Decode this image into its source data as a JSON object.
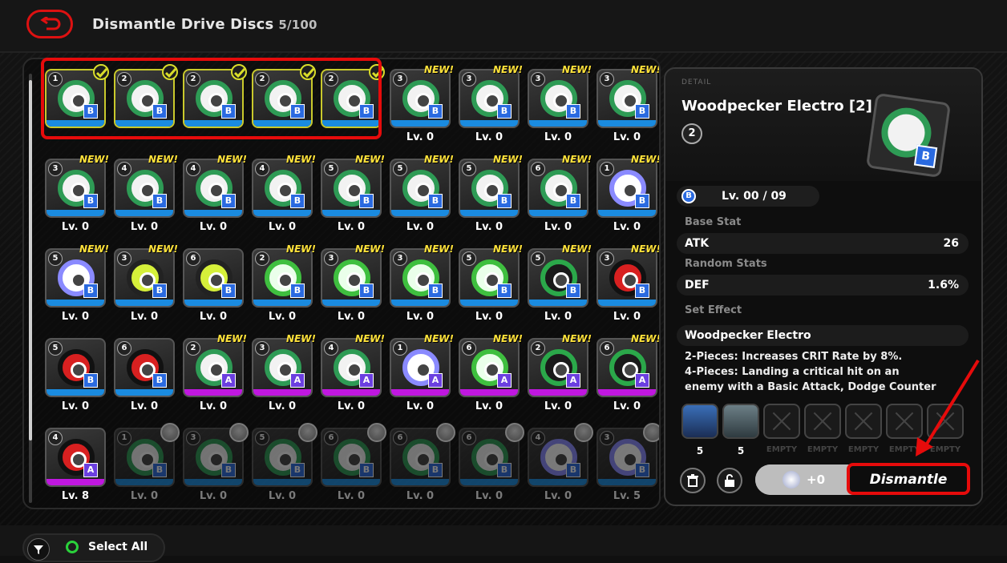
{
  "header": {
    "title": "Dismantle Drive Discs",
    "count": "5/100"
  },
  "grid": {
    "items": [
      {
        "rank": "1",
        "level": "",
        "tag": "check",
        "theme": "",
        "slot": "B",
        "bar": "blue",
        "selected": true
      },
      {
        "rank": "2",
        "level": "",
        "tag": "check",
        "theme": "",
        "slot": "B",
        "bar": "blue",
        "selected": true
      },
      {
        "rank": "2",
        "level": "",
        "tag": "check",
        "theme": "",
        "slot": "B",
        "bar": "blue",
        "selected": true
      },
      {
        "rank": "2",
        "level": "",
        "tag": "check",
        "theme": "",
        "slot": "B",
        "bar": "blue",
        "selected": true
      },
      {
        "rank": "2",
        "level": "",
        "tag": "check",
        "theme": "",
        "slot": "B",
        "bar": "blue",
        "selected": true
      },
      {
        "rank": "3",
        "level": "Lv. 0",
        "tag": "NEW!",
        "theme": "",
        "slot": "B",
        "bar": "blue"
      },
      {
        "rank": "3",
        "level": "Lv. 0",
        "tag": "NEW!",
        "theme": "",
        "slot": "B",
        "bar": "blue"
      },
      {
        "rank": "3",
        "level": "Lv. 0",
        "tag": "NEW!",
        "theme": "",
        "slot": "B",
        "bar": "blue"
      },
      {
        "rank": "3",
        "level": "Lv. 0",
        "tag": "NEW!",
        "theme": "",
        "slot": "B",
        "bar": "blue"
      },
      {
        "rank": "3",
        "level": "Lv. 0",
        "tag": "NEW!",
        "theme": "",
        "slot": "B",
        "bar": "blue"
      },
      {
        "rank": "4",
        "level": "Lv. 0",
        "tag": "NEW!",
        "theme": "",
        "slot": "B",
        "bar": "blue"
      },
      {
        "rank": "4",
        "level": "Lv. 0",
        "tag": "NEW!",
        "theme": "",
        "slot": "B",
        "bar": "blue"
      },
      {
        "rank": "4",
        "level": "Lv. 0",
        "tag": "NEW!",
        "theme": "",
        "slot": "B",
        "bar": "blue"
      },
      {
        "rank": "5",
        "level": "Lv. 0",
        "tag": "NEW!",
        "theme": "",
        "slot": "B",
        "bar": "blue"
      },
      {
        "rank": "5",
        "level": "Lv. 0",
        "tag": "NEW!",
        "theme": "",
        "slot": "B",
        "bar": "blue"
      },
      {
        "rank": "5",
        "level": "Lv. 0",
        "tag": "NEW!",
        "theme": "",
        "slot": "B",
        "bar": "blue"
      },
      {
        "rank": "6",
        "level": "Lv. 0",
        "tag": "NEW!",
        "theme": "",
        "slot": "B",
        "bar": "blue"
      },
      {
        "rank": "1",
        "level": "Lv. 0",
        "tag": "NEW!",
        "theme": "t-white",
        "slot": "B",
        "bar": "blue"
      },
      {
        "rank": "5",
        "level": "Lv. 0",
        "tag": "NEW!",
        "theme": "t-white",
        "slot": "B",
        "bar": "blue"
      },
      {
        "rank": "3",
        "level": "Lv. 0",
        "tag": "NEW!",
        "theme": "t-yellow",
        "slot": "B",
        "bar": "blue"
      },
      {
        "rank": "6",
        "level": "Lv. 0",
        "tag": "",
        "theme": "t-yellow",
        "slot": "B",
        "bar": "blue"
      },
      {
        "rank": "2",
        "level": "Lv. 0",
        "tag": "NEW!",
        "theme": "t-lime",
        "slot": "B",
        "bar": "blue"
      },
      {
        "rank": "3",
        "level": "Lv. 0",
        "tag": "NEW!",
        "theme": "t-lime",
        "slot": "B",
        "bar": "blue"
      },
      {
        "rank": "3",
        "level": "Lv. 0",
        "tag": "NEW!",
        "theme": "t-lime",
        "slot": "B",
        "bar": "blue"
      },
      {
        "rank": "5",
        "level": "Lv. 0",
        "tag": "NEW!",
        "theme": "t-lime",
        "slot": "B",
        "bar": "blue"
      },
      {
        "rank": "5",
        "level": "Lv. 0",
        "tag": "NEW!",
        "theme": "t-green",
        "slot": "B",
        "bar": "blue"
      },
      {
        "rank": "3",
        "level": "Lv. 0",
        "tag": "NEW!",
        "theme": "t-red",
        "slot": "B",
        "bar": "blue"
      },
      {
        "rank": "5",
        "level": "Lv. 0",
        "tag": "",
        "theme": "t-red",
        "slot": "B",
        "bar": "blue"
      },
      {
        "rank": "6",
        "level": "Lv. 0",
        "tag": "",
        "theme": "t-red",
        "slot": "B",
        "bar": "blue"
      },
      {
        "rank": "2",
        "level": "Lv. 0",
        "tag": "NEW!",
        "theme": "",
        "slot": "A",
        "bar": "purple"
      },
      {
        "rank": "3",
        "level": "Lv. 0",
        "tag": "NEW!",
        "theme": "",
        "slot": "A",
        "bar": "purple"
      },
      {
        "rank": "4",
        "level": "Lv. 0",
        "tag": "NEW!",
        "theme": "",
        "slot": "A",
        "bar": "purple"
      },
      {
        "rank": "1",
        "level": "Lv. 0",
        "tag": "NEW!",
        "theme": "t-white",
        "slot": "A",
        "bar": "purple"
      },
      {
        "rank": "6",
        "level": "Lv. 0",
        "tag": "NEW!",
        "theme": "t-lime",
        "slot": "A",
        "bar": "purple"
      },
      {
        "rank": "2",
        "level": "Lv. 0",
        "tag": "NEW!",
        "theme": "t-green",
        "slot": "A",
        "bar": "purple"
      },
      {
        "rank": "6",
        "level": "Lv. 0",
        "tag": "NEW!",
        "theme": "t-green",
        "slot": "A",
        "bar": "purple"
      },
      {
        "rank": "4",
        "level": "Lv. 8",
        "tag": "",
        "theme": "t-red",
        "slot": "A",
        "bar": "purple"
      },
      {
        "rank": "1",
        "level": "Lv. 0",
        "tag": "avatar",
        "theme": "",
        "slot": "B",
        "bar": "blue",
        "dim": true
      },
      {
        "rank": "3",
        "level": "Lv. 0",
        "tag": "avatar",
        "theme": "",
        "slot": "B",
        "bar": "blue",
        "dim": true
      },
      {
        "rank": "5",
        "level": "Lv. 0",
        "tag": "avatar",
        "theme": "",
        "slot": "B",
        "bar": "blue",
        "dim": true
      },
      {
        "rank": "6",
        "level": "Lv. 0",
        "tag": "avatar",
        "theme": "",
        "slot": "B",
        "bar": "blue",
        "dim": true
      },
      {
        "rank": "6",
        "level": "Lv. 0",
        "tag": "avatar",
        "theme": "",
        "slot": "B",
        "bar": "blue",
        "dim": true
      },
      {
        "rank": "6",
        "level": "Lv. 0",
        "tag": "avatar",
        "theme": "",
        "slot": "B",
        "bar": "blue",
        "dim": true
      },
      {
        "rank": "4",
        "level": "Lv. 0",
        "tag": "avatar",
        "theme": "t-white",
        "slot": "B",
        "bar": "blue",
        "dim": true
      },
      {
        "rank": "3",
        "level": "Lv. 5",
        "tag": "avatar",
        "theme": "t-white",
        "slot": "B",
        "bar": "blue",
        "dim": true
      }
    ]
  },
  "detail": {
    "section_label": "DETAIL",
    "name": "Woodpecker Electro [2]",
    "rank": "2",
    "slot_letter": "B",
    "level": "Lv. 00 / 09",
    "base_stat_label": "Base Stat",
    "base_stat": {
      "key": "ATK",
      "value": "26"
    },
    "random_stats_label": "Random Stats",
    "random_stat": {
      "key": "DEF",
      "value": "1.6%"
    },
    "set_effect_label": "Set Effect",
    "set_name": "Woodpecker Electro",
    "effect_line1": "2-Pieces: Increases CRIT Rate by 8%.",
    "effect_line2": "4-Pieces: Landing a critical hit on an",
    "effect_line3": "enemy with a Basic Attack, Dodge Counter",
    "material_slots": [
      {
        "label": "5",
        "filled": true,
        "style": "blue"
      },
      {
        "label": "5",
        "filled": true,
        "style": "grey"
      },
      {
        "label": "EMPTY",
        "filled": false
      },
      {
        "label": "EMPTY",
        "filled": false
      },
      {
        "label": "EMPTY",
        "filled": false
      },
      {
        "label": "EMPTY",
        "filled": false
      },
      {
        "label": "EMPTY",
        "filled": false
      }
    ],
    "reward": "+0",
    "dismantle_label": "Dismantle"
  },
  "footer": {
    "select_all": "Select All"
  },
  "colors": {
    "highlight_red": "#e60b0b",
    "selected_yellow": "#c9c92c",
    "bar_blue": "#1a8be0",
    "bar_purple": "#c017e0",
    "new_yellow": "#ffe23a"
  }
}
